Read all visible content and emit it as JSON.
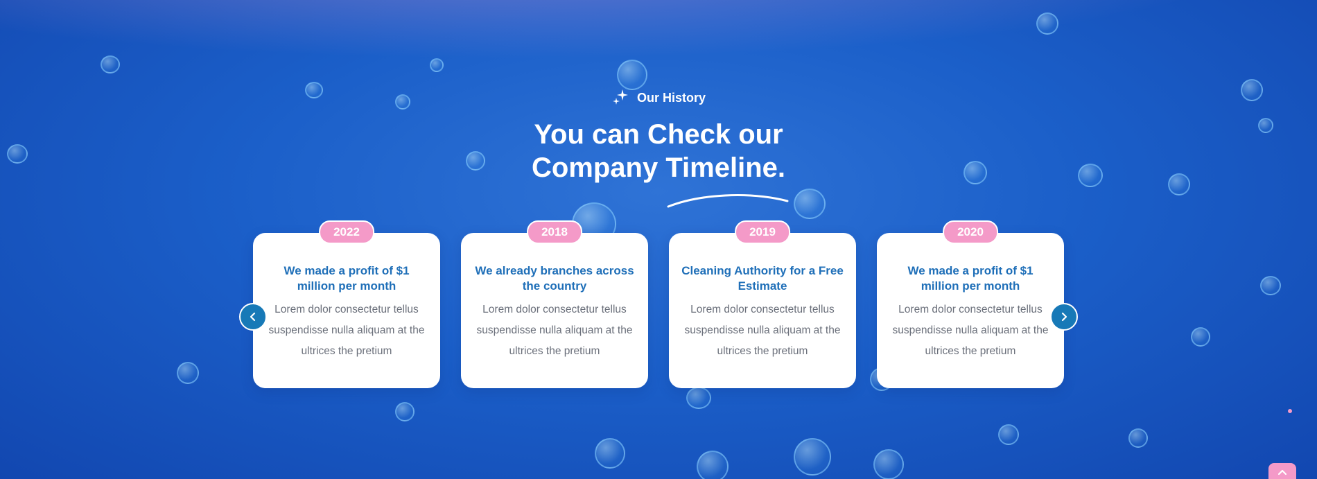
{
  "section": {
    "eyebrow": "Our History",
    "heading_line1": "You can Check our",
    "heading_line2": "Company Timeline."
  },
  "timeline": [
    {
      "year": "2022",
      "title": "We made a profit of $1 million per month",
      "text": "Lorem dolor consectetur tellus suspendisse nulla aliquam at the ultrices the pretium"
    },
    {
      "year": "2018",
      "title": "We already branches across the country",
      "text": "Lorem dolor consectetur tellus suspendisse nulla aliquam at the ultrices the pretium"
    },
    {
      "year": "2019",
      "title": "Cleaning Authority for a Free Estimate",
      "text": "Lorem dolor consectetur tellus suspendisse nulla aliquam at the ultrices the pretium"
    },
    {
      "year": "2020",
      "title": "We made a profit of $1 million per month",
      "text": "Lorem dolor consectetur tellus suspendisse nulla aliquam at the ultrices the pretium"
    }
  ],
  "icons": {
    "eyebrow": "sparkle-icon",
    "prev": "chevron-left-icon",
    "next": "chevron-right-icon",
    "scroll_top": "chevron-up-icon"
  },
  "colors": {
    "background": "#1b5fc9",
    "badge": "#f49ac8",
    "card_title": "#1f6fb8",
    "nav_button": "#1779b7",
    "card_text": "#6a6f7a"
  }
}
